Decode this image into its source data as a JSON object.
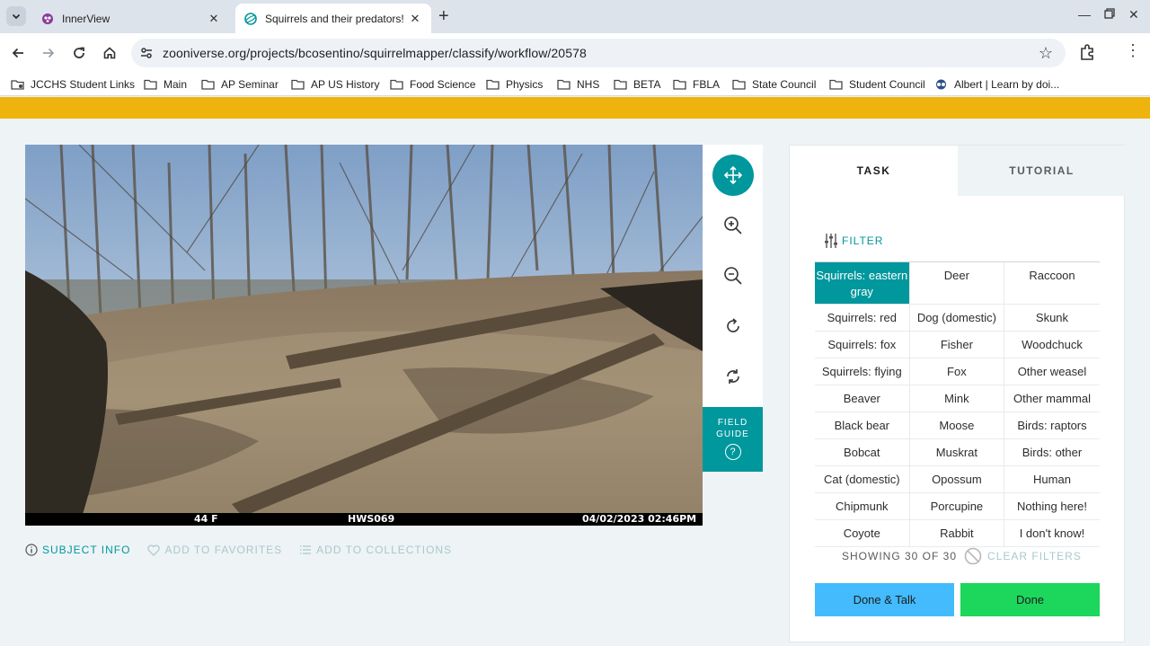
{
  "browser": {
    "tabs": [
      {
        "title": "InnerView",
        "active": false
      },
      {
        "title": "Squirrels and their predators! |",
        "active": true
      }
    ],
    "url": "zooniverse.org/projects/bcosentino/squirrelmapper/classify/workflow/20578",
    "bookmarks": [
      "JCCHS Student Links",
      "Main",
      "AP Seminar",
      "AP US History",
      "Food Science",
      "Physics",
      "NHS",
      "BETA",
      "FBLA",
      "State Council",
      "Student Council",
      "Albert | Learn by doi..."
    ]
  },
  "colors": {
    "accent": "#00979d",
    "banner": "#efb30d",
    "done_talk": "#43bbfd",
    "done": "#1dd65c"
  },
  "subject": {
    "stamp_temp": "44 F",
    "stamp_camera": "HWS069",
    "stamp_datetime": "04/02/2023  02:46PM"
  },
  "image_tools": {
    "icons": [
      "move-icon",
      "zoom-in-icon",
      "zoom-out-icon",
      "rotate-icon",
      "reset-icon"
    ],
    "field_guide_line1": "FIELD",
    "field_guide_line2": "GUIDE",
    "field_guide_q": "?"
  },
  "meta": {
    "subject_info": "SUBJECT INFO",
    "add_favorites": "ADD TO FAVORITES",
    "add_collections": "ADD TO COLLECTIONS"
  },
  "panel": {
    "tab_task": "TASK",
    "tab_tutorial": "TUTORIAL",
    "filter": "FILTER",
    "choices": [
      [
        "Squirrels: eastern gray",
        "Deer",
        "Raccoon"
      ],
      [
        "Squirrels: red",
        "Dog (domestic)",
        "Skunk"
      ],
      [
        "Squirrels: fox",
        "Fisher",
        "Woodchuck"
      ],
      [
        "Squirrels: flying",
        "Fox",
        "Other weasel"
      ],
      [
        "Beaver",
        "Mink",
        "Other mammal"
      ],
      [
        "Black bear",
        "Moose",
        "Birds: raptors"
      ],
      [
        "Bobcat",
        "Muskrat",
        "Birds: other"
      ],
      [
        "Cat (domestic)",
        "Opossum",
        "Human"
      ],
      [
        "Chipmunk",
        "Porcupine",
        "Nothing here!"
      ],
      [
        "Coyote",
        "Rabbit",
        "I don't know!"
      ]
    ],
    "selected_choice": "Squirrels: eastern gray",
    "showing": "SHOWING 30 OF 30",
    "clear_filters": "CLEAR FILTERS",
    "done_talk": "Done & Talk",
    "done": "Done"
  }
}
